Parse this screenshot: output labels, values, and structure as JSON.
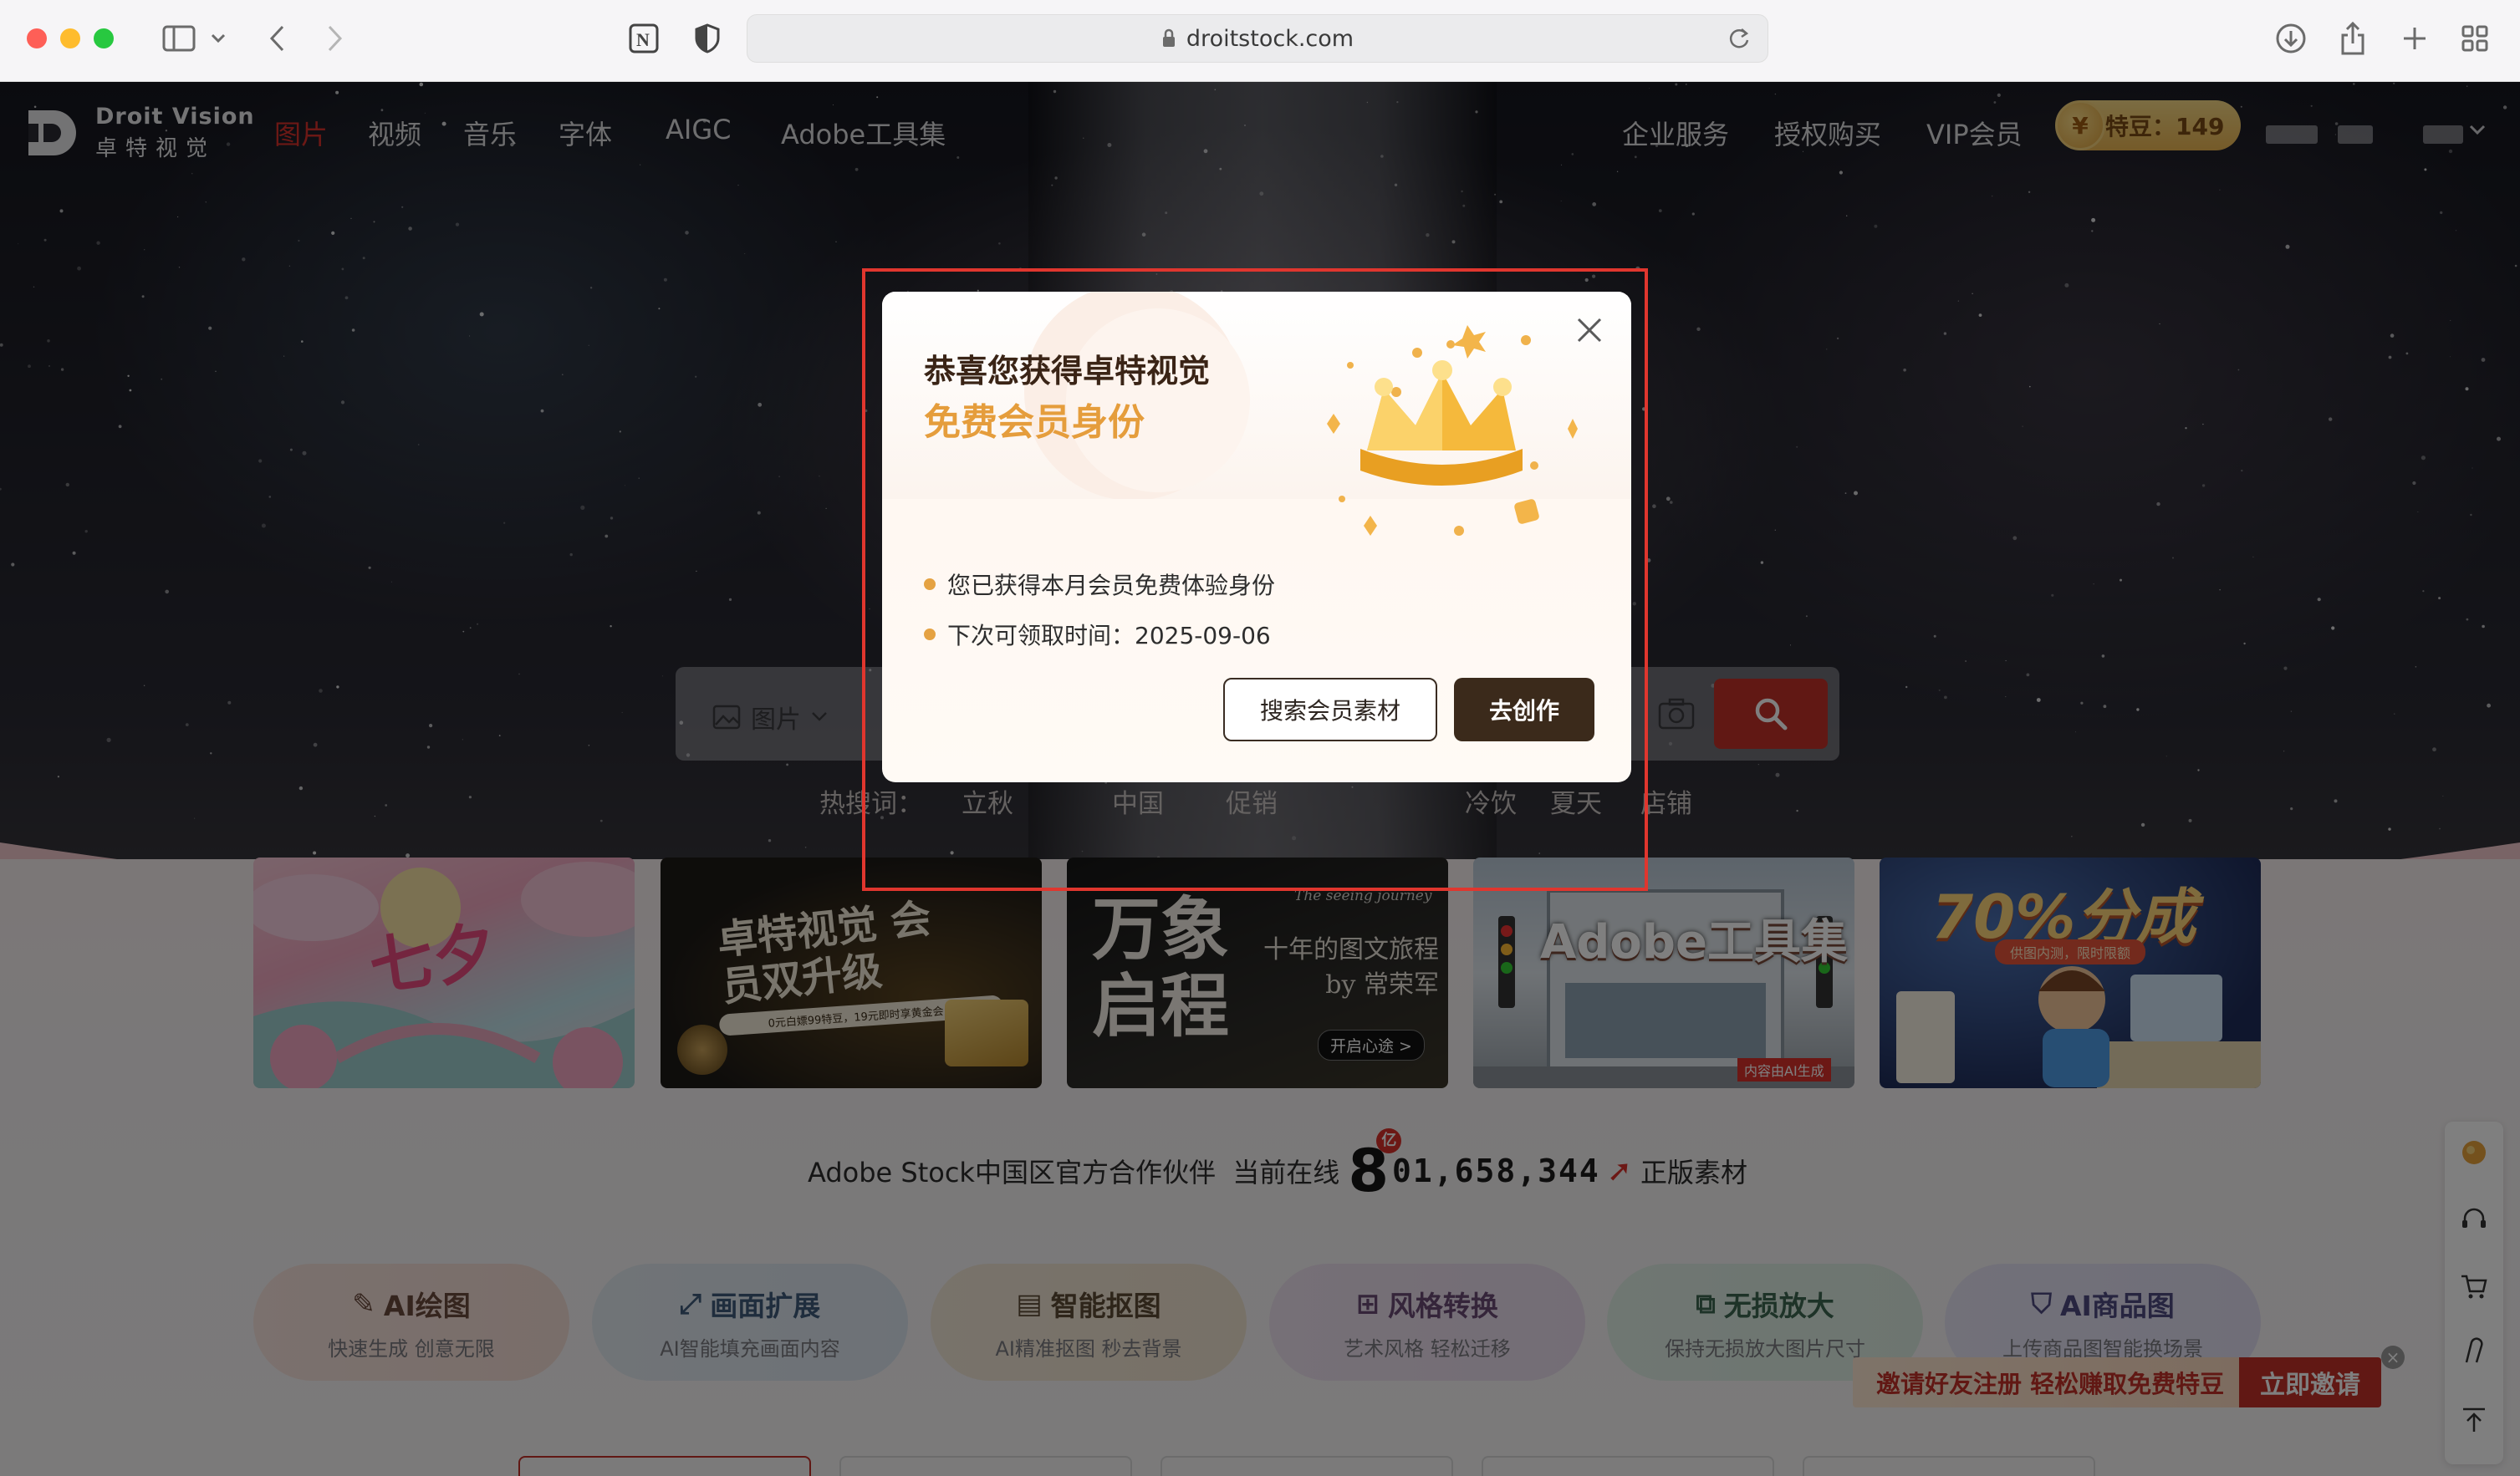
{
  "browser": {
    "url": "droitstock.com"
  },
  "nav": {
    "logo_en": "Droit Vision",
    "logo_cn": "卓特视觉",
    "items": [
      "图片",
      "视频",
      "音乐",
      "字体",
      "AIGC",
      "Adobe工具集"
    ],
    "right_items": [
      "企业服务",
      "授权购买",
      "VIP会员"
    ],
    "beans": "特豆：149"
  },
  "search": {
    "type_label": "图片",
    "hot_label": "热搜词：",
    "hot_words": [
      "立秋",
      "",
      "中国",
      "促销",
      "",
      "",
      "冷饮",
      "夏天",
      "店铺"
    ]
  },
  "banners": [
    {
      "title": "七夕"
    },
    {
      "title": "卓特视觉 会员双升级",
      "sub": "0元白嫖99特豆，19元即时享黄金会员"
    },
    {
      "title": "万象启程",
      "tag": "The seeing journey",
      "sub": "十年的图文旅程 by 常荣军",
      "btn": "开启心途 >"
    },
    {
      "title": "Adobe工具集",
      "sub": "内容由AI生成"
    },
    {
      "title": "70%分成",
      "sub": "供图内测，限时限额"
    }
  ],
  "stats": {
    "prefix": "Adobe Stock中国区官方合作伙伴  当前在线",
    "big": "8",
    "unit": "亿",
    "digits": "01,658,344",
    "suffix": "正版素材"
  },
  "tools": [
    {
      "title": "AI绘图",
      "sub": "快速生成 创意无限",
      "color": "#6a4a3c"
    },
    {
      "title": "画面扩展",
      "sub": "AI智能填充画面内容",
      "color": "#3f5b7a"
    },
    {
      "title": "智能抠图",
      "sub": "AI精准抠图 秒去背景",
      "color": "#5c4a35"
    },
    {
      "title": "风格转换",
      "sub": "艺术风格 轻松迁移",
      "color": "#6a4a74"
    },
    {
      "title": "无损放大",
      "sub": "保持无损放大图片尺寸",
      "color": "#3c6650"
    },
    {
      "title": "AI商品图",
      "sub": "上传商品图智能换场景",
      "color": "#4e4a80"
    }
  ],
  "invite": {
    "text": "邀请好友注册 轻松赚取免费特豆",
    "button": "立即邀请"
  },
  "modal": {
    "title_line1": "恭喜您获得卓特视觉",
    "title_line2": "免费会员身份",
    "lines": [
      "您已获得本月会员免费体验身份",
      "下次可领取时间：2025-09-06"
    ],
    "btn_search": "搜索会员素材",
    "btn_create": "去创作"
  },
  "colors": {
    "brand_red": "#c33128",
    "accent_gold": "#e59d3c",
    "modal_button_dark": "#3b2a1b"
  }
}
